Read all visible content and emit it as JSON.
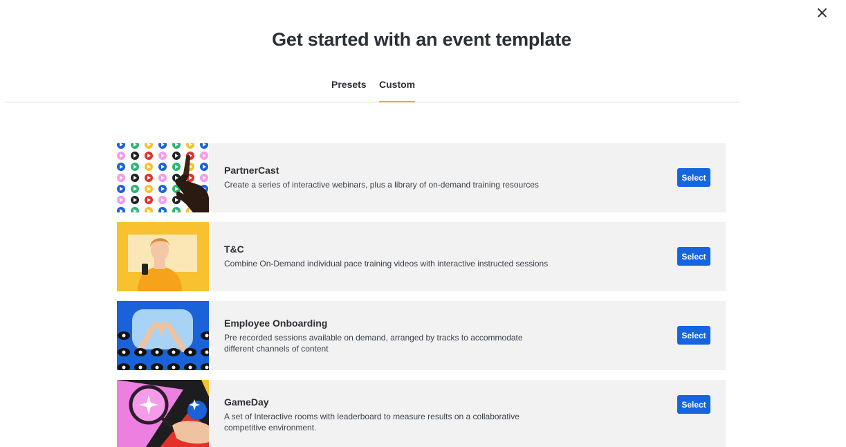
{
  "dialog": {
    "title": "Get started with an event template",
    "close_icon": "close-icon"
  },
  "tabs": [
    {
      "label": "Presets",
      "active": false
    },
    {
      "label": "Custom",
      "active": true
    }
  ],
  "colors": {
    "accent": "#f5a623",
    "button": "#1565e0",
    "card_bg": "#f2f2f2"
  },
  "templates": [
    {
      "title": "PartnerCast",
      "description": "Create a series of interactive webinars, plus a library of on-demand training resources",
      "button_label": "Select"
    },
    {
      "title": "T&C",
      "description": "Combine On-Demand individual pace training videos with interactive instructed sessions",
      "button_label": "Select"
    },
    {
      "title": "Employee Onboarding",
      "description": "Pre recorded sessions available on demand, arranged by tracks to accommodate different channels of content",
      "button_label": "Select"
    },
    {
      "title": "GameDay",
      "description": "A set of Interactive rooms with leaderboard to measure results on a collaborative competitive environment.",
      "button_label": "Select"
    }
  ]
}
